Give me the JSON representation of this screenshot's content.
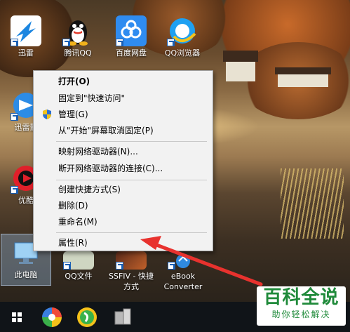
{
  "desktop": {
    "icons": [
      {
        "label": "迅雷",
        "icon": "xunlei-icon"
      },
      {
        "label": "腾讯QQ",
        "icon": "qq-penguin-icon"
      },
      {
        "label": "百度网盘",
        "icon": "baidu-netdisk-icon"
      },
      {
        "label": "QQ浏览器",
        "icon": "qq-browser-icon"
      },
      {
        "label": "迅雷影",
        "icon": "xunlei-video-icon"
      },
      {
        "label": "优酷",
        "icon": "youku-icon"
      },
      {
        "label": "此电脑",
        "icon": "this-pc-icon"
      },
      {
        "label": "QQ文件",
        "icon": "qq-file-icon"
      },
      {
        "label": "SSFIV - 快捷方式",
        "icon": "ssfiv-game-icon"
      },
      {
        "label": "eBook Converter",
        "icon": "ebook-converter-icon"
      }
    ]
  },
  "context_menu": {
    "items": [
      {
        "label": "打开(O)",
        "bold": true
      },
      {
        "label": "固定到\"快速访问\""
      },
      {
        "label": "管理(G)",
        "icon": "uac-shield-icon"
      },
      {
        "label": "从\"开始\"屏幕取消固定(P)"
      },
      {
        "label": "映射网络驱动器(N)..."
      },
      {
        "label": "断开网络驱动器的连接(C)..."
      },
      {
        "label": "创建快捷方式(S)"
      },
      {
        "label": "删除(D)"
      },
      {
        "label": "重命名(M)"
      },
      {
        "label": "属性(R)"
      }
    ]
  },
  "annotation": {
    "arrow_color": "#e8322e",
    "points_to": "属性(R)"
  },
  "taskbar": {
    "items": [
      {
        "icon": "windows-start-icon"
      },
      {
        "icon": "color-wheel-app-icon"
      },
      {
        "icon": "green-circle-app-icon"
      },
      {
        "icon": "computer-tower-icon"
      }
    ]
  },
  "watermark": {
    "title": "百科全说",
    "subtitle": "助你轻松解决"
  }
}
